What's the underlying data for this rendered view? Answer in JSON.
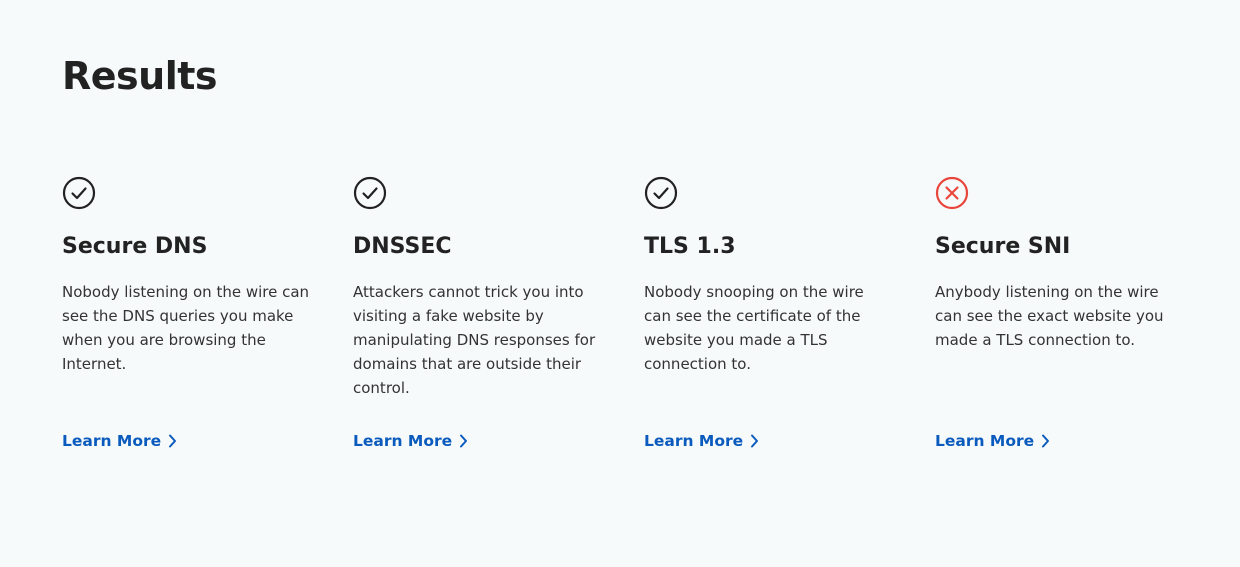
{
  "page": {
    "title": "Results"
  },
  "colors": {
    "pass": "#222222",
    "fail": "#e8463c",
    "link": "#0a5bbd",
    "background": "#f7fafb"
  },
  "cards": [
    {
      "status": "pass",
      "icon": "check-circle-icon",
      "title": "Secure DNS",
      "description": "Nobody listening on the wire can see the DNS queries you make when you are browsing the Internet.",
      "link_label": "Learn More"
    },
    {
      "status": "pass",
      "icon": "check-circle-icon",
      "title": "DNSSEC",
      "description": "Attackers cannot trick you into visiting a fake website by manipulating DNS responses for domains that are outside their control.",
      "link_label": "Learn More"
    },
    {
      "status": "pass",
      "icon": "check-circle-icon",
      "title": "TLS 1.3",
      "description": "Nobody snooping on the wire can see the certificate of the website you made a TLS connection to.",
      "link_label": "Learn More"
    },
    {
      "status": "fail",
      "icon": "x-circle-icon",
      "title": "Secure SNI",
      "description": "Anybody listening on the wire can see the exact website you made a TLS connection to.",
      "link_label": "Learn More"
    }
  ]
}
